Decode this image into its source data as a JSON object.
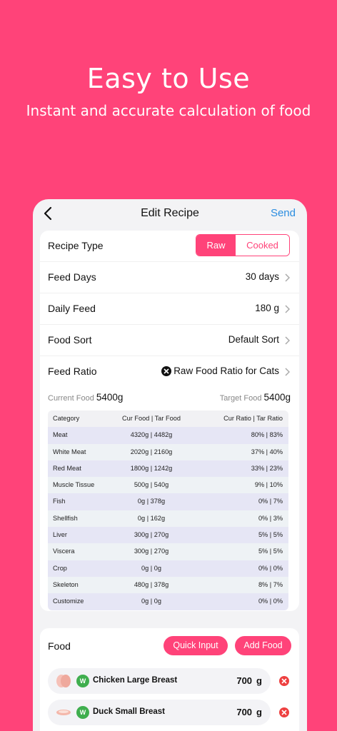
{
  "hero": {
    "title": "Easy to Use",
    "subtitle": "Instant and accurate calculation of food"
  },
  "nav": {
    "title": "Edit Recipe",
    "send": "Send"
  },
  "recipe": {
    "type_label": "Recipe Type",
    "type_options": [
      "Raw",
      "Cooked"
    ],
    "type_selected": "Raw",
    "feed_days_label": "Feed Days",
    "feed_days_value": "30 days",
    "daily_feed_label": "Daily Feed",
    "daily_feed_value": "180 g",
    "food_sort_label": "Food Sort",
    "food_sort_value": "Default Sort",
    "feed_ratio_label": "Feed Ratio",
    "feed_ratio_value": "Raw Food Ratio for Cats"
  },
  "totals": {
    "current_label": "Current Food",
    "current_value": "5400g",
    "target_label": "Target Food",
    "target_value": "5400g"
  },
  "table": {
    "headers": [
      "Category",
      "Cur Food | Tar Food",
      "Cur Ratio | Tar Ratio"
    ],
    "rows": [
      [
        "Meat",
        "4320g | 4482g",
        "80% | 83%"
      ],
      [
        "White Meat",
        "2020g | 2160g",
        "37% | 40%"
      ],
      [
        "Red Meat",
        "1800g | 1242g",
        "33% | 23%"
      ],
      [
        "Muscle Tissue",
        "500g | 540g",
        "9% | 10%"
      ],
      [
        "Fish",
        "0g | 378g",
        "0% | 7%"
      ],
      [
        "Shellfish",
        "0g | 162g",
        "0% | 3%"
      ],
      [
        "Liver",
        "300g | 270g",
        "5% | 5%"
      ],
      [
        "Viscera",
        "300g | 270g",
        "5% | 5%"
      ],
      [
        "Crop",
        "0g | 0g",
        "0% | 0%"
      ],
      [
        "Skeleton",
        "480g | 378g",
        "8% | 7%"
      ],
      [
        "Customize",
        "0g | 0g",
        "0% | 0%"
      ]
    ]
  },
  "food": {
    "label": "Food",
    "quick_input": "Quick Input",
    "add_food": "Add Food",
    "items": [
      {
        "badge": "W",
        "name": "Chicken Large Breast",
        "amount": "700",
        "unit": "g"
      },
      {
        "badge": "W",
        "name": "Duck Small Breast",
        "amount": "700",
        "unit": "g"
      }
    ]
  },
  "colors": {
    "accent": "#ff4379",
    "link": "#2b8de0",
    "badge": "#3fae4e",
    "delete": "#ee4040"
  }
}
